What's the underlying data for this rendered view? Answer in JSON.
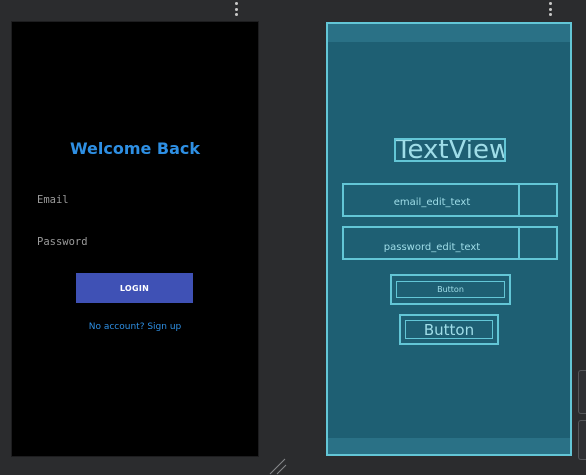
{
  "design_preview": {
    "title": "Welcome Back",
    "email_hint": "Email",
    "password_hint": "Password",
    "login_button": "LOGIN",
    "signup_link": "No account? Sign up"
  },
  "blueprint": {
    "title_view": "TextView",
    "email_field": "email_edit_text",
    "password_field": "password_edit_text",
    "button_1": "Button",
    "button_2": "Button"
  },
  "icons": {
    "design_menu": "more-vert-icon",
    "blueprint_menu": "more-vert-icon",
    "resize": "resize-handle-icon"
  },
  "colors": {
    "canvas": "#2b2c2e",
    "design_bg": "#000000",
    "accent_blue": "#2e8fe3",
    "login_button": "#3f51b5",
    "blueprint_bg": "#1e5f73",
    "blueprint_line": "#63c6d6"
  }
}
